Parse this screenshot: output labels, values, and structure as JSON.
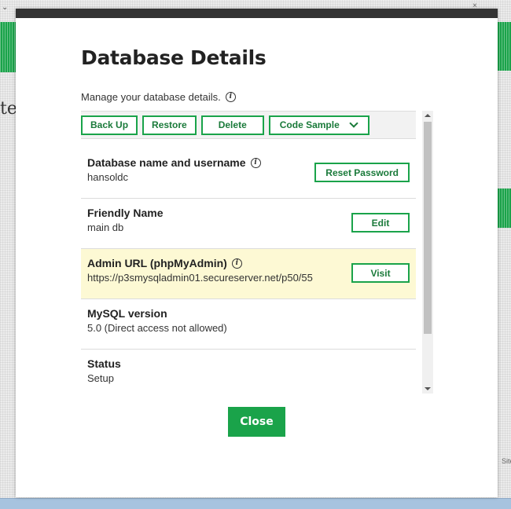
{
  "background": {
    "partial_text": "te",
    "chevron": "⌄",
    "close_glyph": "×",
    "side_text": "Site"
  },
  "modal": {
    "title": "Database Details",
    "subtitle": "Manage your database details.",
    "toolbar": {
      "back_up": "Back Up",
      "restore": "Restore",
      "delete": "Delete",
      "code_sample": "Code Sample"
    },
    "rows": [
      {
        "label": "Database name and username",
        "value": "hansoldc",
        "button": "Reset Password",
        "has_info": true
      },
      {
        "label": "Friendly Name",
        "value": "main db",
        "button": "Edit",
        "has_info": false
      },
      {
        "label": "Admin URL (phpMyAdmin)",
        "value": "https://p3smysqladmin01.secureserver.net/p50/55",
        "button": "Visit",
        "has_info": true,
        "highlighted": true
      },
      {
        "label": "MySQL version",
        "value": "5.0 (Direct access not allowed)"
      },
      {
        "label": "Status",
        "value": "Setup"
      }
    ],
    "close_label": "Close"
  },
  "colors": {
    "accent_green": "#1aa34a",
    "highlight_row": "#fdf9d4"
  },
  "icons": {
    "info": "info-icon",
    "dropdown": "chevron-down-icon"
  }
}
